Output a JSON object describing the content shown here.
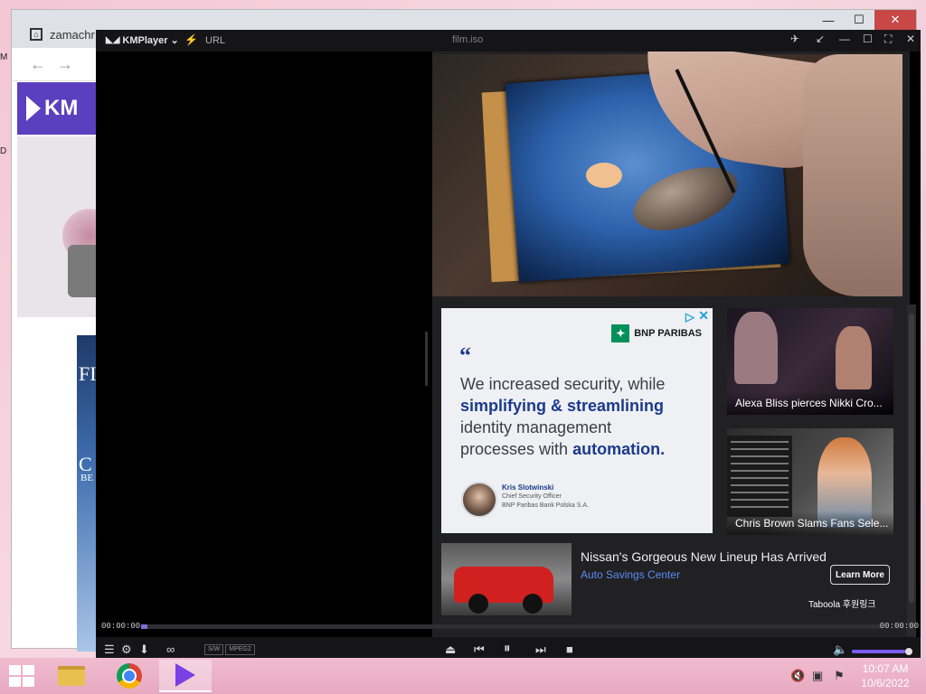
{
  "browser": {
    "tab_title": "zamachr",
    "nav": {
      "back": "←",
      "forward": "→"
    },
    "logo_text": "KM",
    "book_text_1": "FI",
    "book_text_2": "C",
    "book_text_3": "BE",
    "win": {
      "minimize": "—",
      "maximize": "☐",
      "close": "✕"
    }
  },
  "desktop_marks": {
    "m1": "M",
    "m2": "D"
  },
  "kmplayer": {
    "brand": "KMPlayer",
    "url_label": "URL",
    "file_name": "film.iso",
    "ad": {
      "bank_name": "BNP PARIBAS",
      "quote_mark": "“",
      "copy_1": "We increased security, while",
      "copy_em_1": "simplifying & streamlining",
      "copy_2": "identity management",
      "copy_3": "processes with",
      "copy_em_2": "automation.",
      "person_name": "Kris Slotwinski",
      "person_title": "Chief Security Officer",
      "person_company": "BNP Paribas Bank Polska S.A."
    },
    "videos": [
      {
        "caption": "Alexa Bliss pierces Nikki Cro..."
      },
      {
        "caption": "Chris Brown Slams Fans Sele..."
      }
    ],
    "taboola_item": {
      "title": "Nissan's Gorgeous New Lineup Has Arrived",
      "source": "Auto Savings Center",
      "cta": "Learn More"
    },
    "taboola_label": "Taboola 후원링크",
    "time_elapsed": "00:00:00",
    "time_total": "00:00:00",
    "seek_fraction": 0.0,
    "codec_sw": "S/W",
    "codec_fmt": "MPEG2",
    "volume_fraction": 0.92
  },
  "taskbar": {
    "time": "10:07 AM",
    "date": "10/6/2022"
  }
}
